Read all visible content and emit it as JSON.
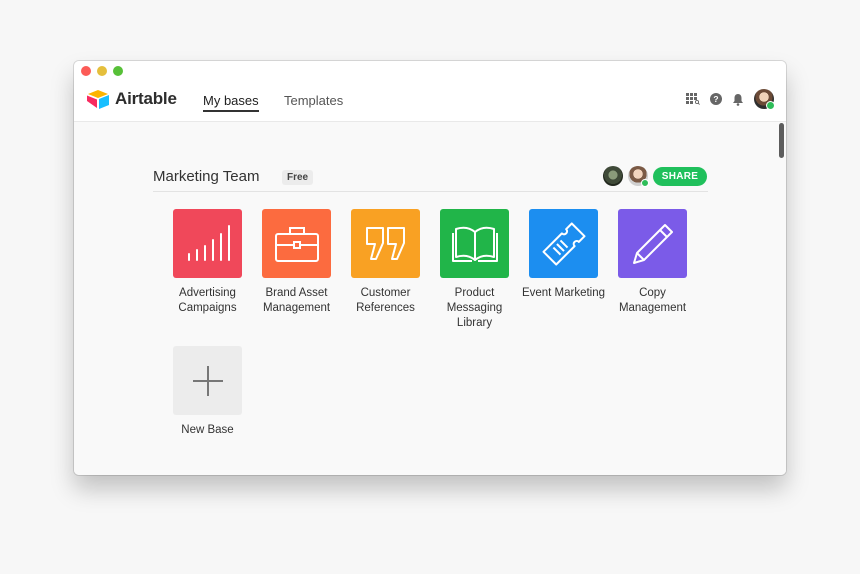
{
  "app": {
    "name": "Airtable",
    "nav": [
      {
        "label": "My bases",
        "active": true
      },
      {
        "label": "Templates",
        "active": false
      }
    ],
    "right_icons": [
      "apps-grid-icon",
      "help-icon",
      "bell-icon",
      "user-avatar"
    ]
  },
  "workspace": {
    "title": "Marketing Team",
    "plan_badge": "Free",
    "share_label": "SHARE",
    "collaborators": [
      "collaborator-avatar",
      "collaborator-avatar-online"
    ]
  },
  "bases": [
    {
      "label": "Advertising Campaigns",
      "color": "#f0485a",
      "icon": "bar-chart-icon"
    },
    {
      "label": "Brand Asset Management",
      "color": "#fc6b3f",
      "icon": "briefcase-icon"
    },
    {
      "label": "Customer References",
      "color": "#f9a123",
      "icon": "quote-icon"
    },
    {
      "label": "Product Messaging Library",
      "color": "#21b549",
      "icon": "book-icon"
    },
    {
      "label": "Event Marketing",
      "color": "#1c8ef0",
      "icon": "ticket-icon"
    },
    {
      "label": "Copy Management",
      "color": "#7b5be8",
      "icon": "pencil-icon"
    }
  ],
  "new_base": {
    "label": "New Base",
    "icon": "plus-icon"
  },
  "colors": {
    "share": "#20c05c",
    "online": "#2ebd59"
  }
}
